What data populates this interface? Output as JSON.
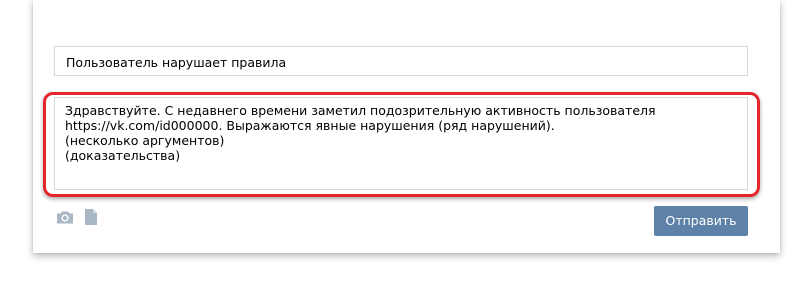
{
  "subject": {
    "value": "Пользователь нарушает правила"
  },
  "message": {
    "lines": [
      "Здравствуйте. С недавнего времени заметил подозрительную активность пользователя",
      "https://vk.com/id000000. Выражаются явные нарушения (ряд нарушений).",
      "(несколько аргументов)",
      "(доказательства)"
    ]
  },
  "attachments": {
    "icons": [
      "camera-icon",
      "document-icon"
    ]
  },
  "send_button": {
    "label": "Отправить"
  },
  "colors": {
    "highlight": "#e3262b",
    "button": "#5e81a8",
    "icon": "#aab8c6",
    "border": "#d3d9de"
  }
}
